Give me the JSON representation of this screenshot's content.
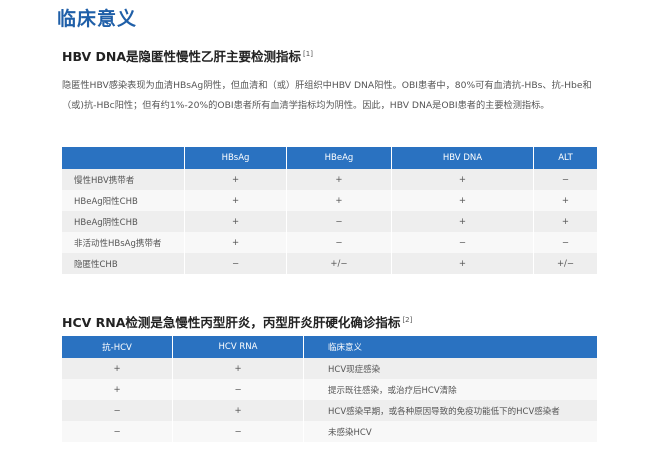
{
  "page_title": "临床意义",
  "section1": {
    "title": "HBV DNA是隐匿性慢性乙肝主要检测指标",
    "ref": "[1]",
    "paragraph": "隐匿性HBV感染表现为血清HBsAg阴性，但血清和（或）肝组织中HBV  DNA阳性。OBI患者中，80%可有血清抗-HBs、抗-Hbe和（或)抗-HBc阳性；但有约1%-20%的OBI患者所有血清学指标均为阴性。因此，HBV DNA是OBI患者的主要检测指标。",
    "table": {
      "headers": [
        "",
        "HBsAg",
        "HBeAg",
        "HBV DNA",
        "ALT"
      ],
      "rows": [
        [
          "慢性HBV携带者",
          "+",
          "+",
          "+",
          "−"
        ],
        [
          "HBeAg阳性CHB",
          "+",
          "+",
          "+",
          "+"
        ],
        [
          "HBeAg阴性CHB",
          "+",
          "−",
          "+",
          "+"
        ],
        [
          "非活动性HBsAg携带者",
          "+",
          "−",
          "−",
          "−"
        ],
        [
          "隐匿性CHB",
          "−",
          "+/−",
          "+",
          "+/−"
        ]
      ]
    }
  },
  "section2": {
    "title": "HCV RNA检测是急慢性丙型肝炎，丙型肝炎肝硬化确诊指标",
    "ref": "[2]",
    "table": {
      "headers": [
        "抗-HCV",
        "HCV RNA",
        "临床意义"
      ],
      "rows": [
        [
          "+",
          "+",
          "HCV现症感染"
        ],
        [
          "+",
          "−",
          "提示既往感染，或治疗后HCV清除"
        ],
        [
          "−",
          "+",
          "HCV感染早期，或各种原因导致的免疫功能低下的HCV感染者"
        ],
        [
          "−",
          "−",
          "未感染HCV"
        ]
      ]
    }
  }
}
